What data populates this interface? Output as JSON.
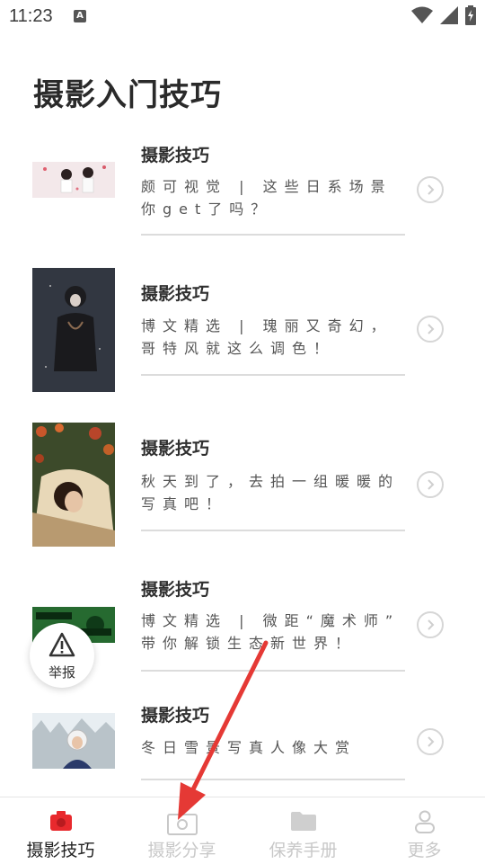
{
  "status": {
    "time": "11:23",
    "notif_letter": "A"
  },
  "page": {
    "title": "摄影入门技巧"
  },
  "articles": [
    {
      "title": "摄影技巧",
      "line1": "颇可视觉 | 这些日系场景",
      "line2": "你get了吗？"
    },
    {
      "title": "摄影技巧",
      "line1": "博文精选 | 瑰丽又奇幻，",
      "line2": "哥特风就这么调色！"
    },
    {
      "title": "摄影技巧",
      "line1": "秋天到了，去拍一组暖暖的",
      "line2": "写真吧！"
    },
    {
      "title": "摄影技巧",
      "line1": "博文精选 | 微距“魔术师”",
      "line2": "带你解锁生态新世界！"
    },
    {
      "title": "摄影技巧",
      "line1": "冬日雪景写真人像大赏",
      "line2": ""
    }
  ],
  "report": {
    "label": "举报"
  },
  "tabs": [
    {
      "label": "摄影技巧",
      "icon": "camera-icon",
      "active": true
    },
    {
      "label": "摄影分享",
      "icon": "photo-share-icon",
      "active": false
    },
    {
      "label": "保养手册",
      "icon": "folder-icon",
      "active": false
    },
    {
      "label": "更多",
      "icon": "person-icon",
      "active": false
    }
  ],
  "colors": {
    "active_icon": "#e8292d",
    "inactive": "#c8c8c8",
    "arrow": "#e53935"
  }
}
